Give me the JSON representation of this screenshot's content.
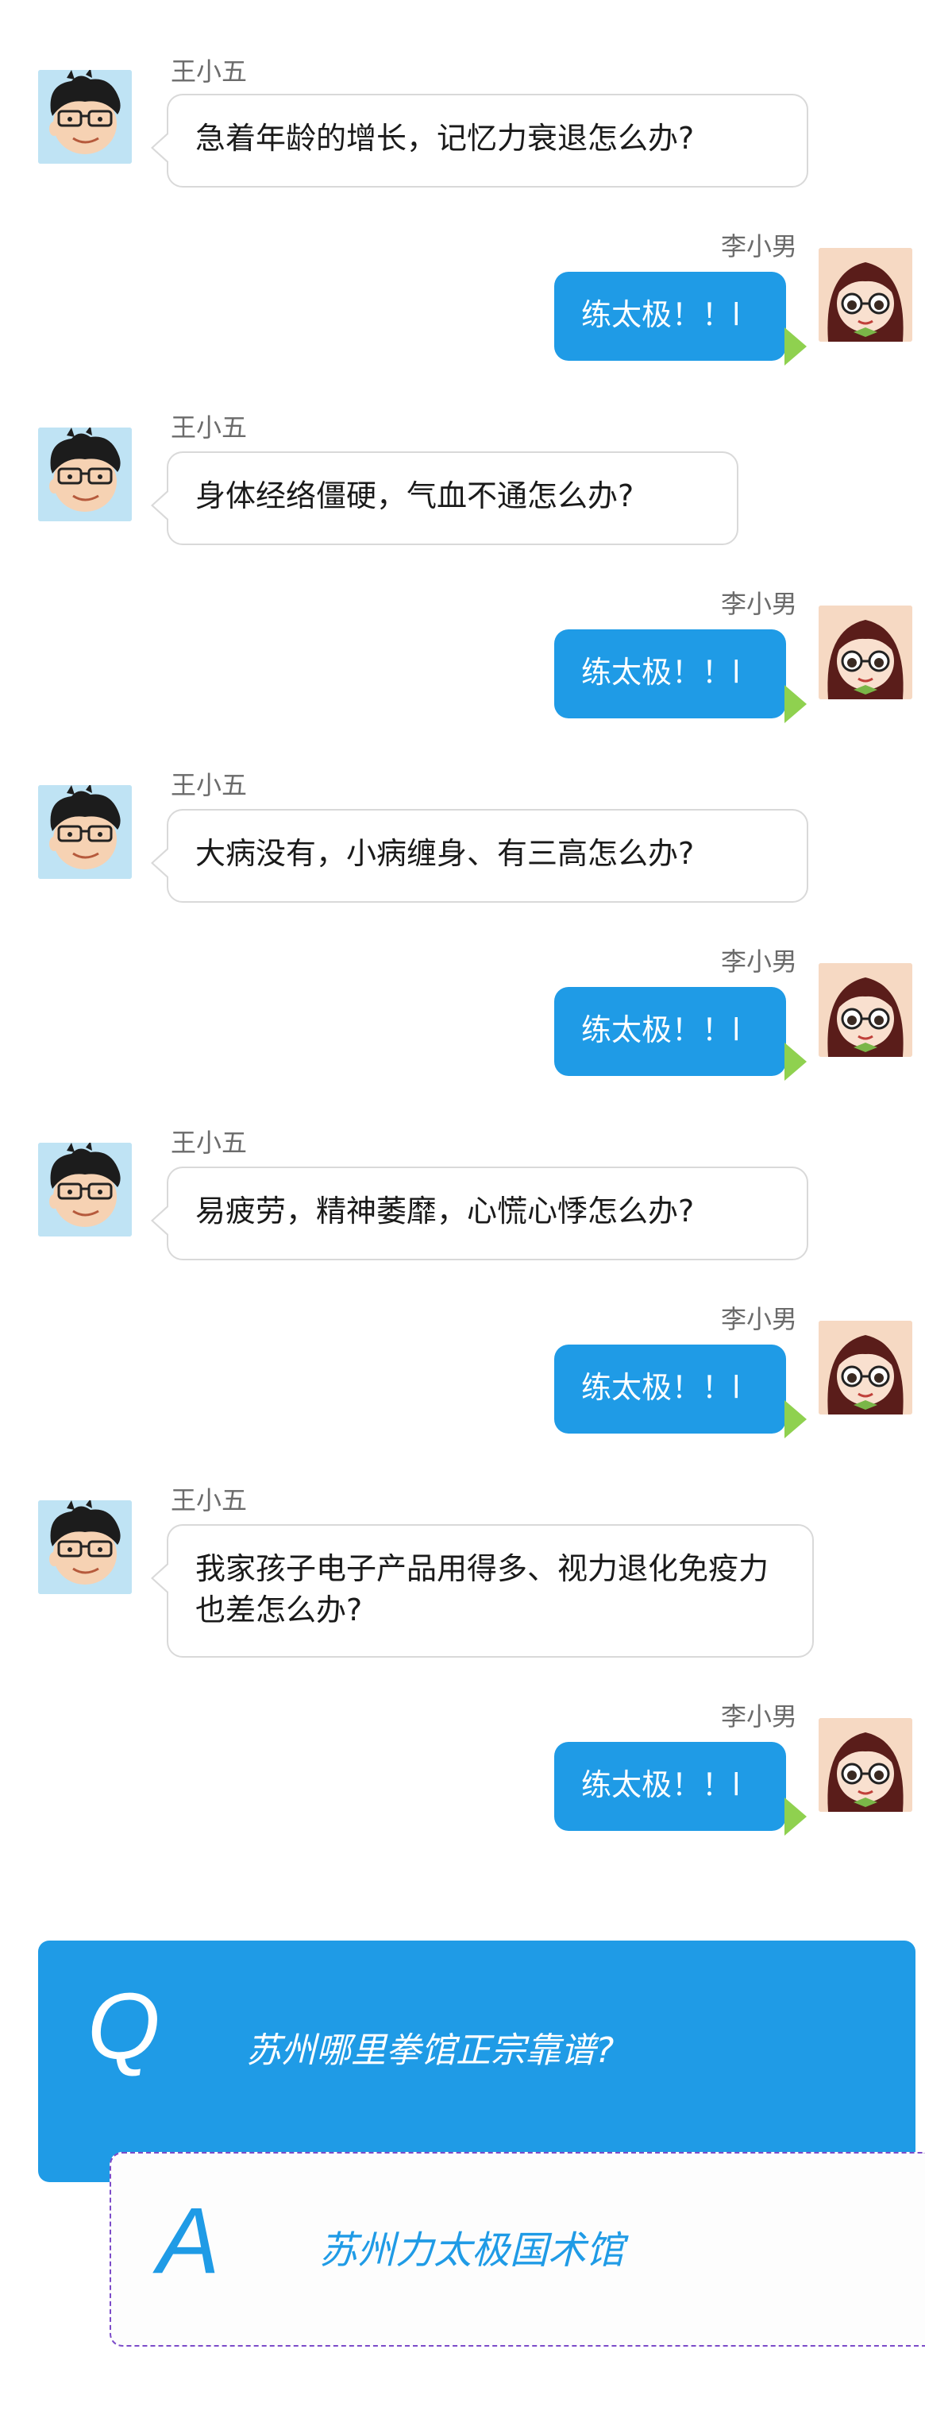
{
  "chat": {
    "messages": [
      {
        "sender": "王小五",
        "side": "left",
        "text": "急着年龄的增长，记忆力衰退怎么办?"
      },
      {
        "sender": "李小男",
        "side": "right",
        "text": "练太极！！l"
      },
      {
        "sender": "王小五",
        "side": "left",
        "text": "身体经络僵硬，气血不通怎么办?"
      },
      {
        "sender": "李小男",
        "side": "right",
        "text": "练太极！！l"
      },
      {
        "sender": "王小五",
        "side": "left",
        "text": "大病没有，小病缠身、有三高怎么办?"
      },
      {
        "sender": "李小男",
        "side": "right",
        "text": "练太极！！l"
      },
      {
        "sender": "王小五",
        "side": "left",
        "text": "易疲劳，精神萎靡，心慌心悸怎么办?"
      },
      {
        "sender": "李小男",
        "side": "right",
        "text": "练太极！！l"
      },
      {
        "sender": "王小五",
        "side": "left",
        "text": "我家孩子电子产品用得多、视力退化免疫力也差怎么办?"
      },
      {
        "sender": "李小男",
        "side": "right",
        "text": "练太极！！l"
      }
    ]
  },
  "qa": {
    "q_letter": "Q",
    "question": "苏州哪里拳馆正宗靠谱?",
    "a_letter": "A",
    "answer": "苏州力太极国术馆"
  },
  "colors": {
    "accent": "#1f9be6",
    "bubble_tail": "#8fd14f",
    "dashed_border": "#7c4bc9"
  },
  "icons": {
    "left_avatar": "cartoon-boy-avatar",
    "right_avatar": "cartoon-girl-avatar"
  }
}
